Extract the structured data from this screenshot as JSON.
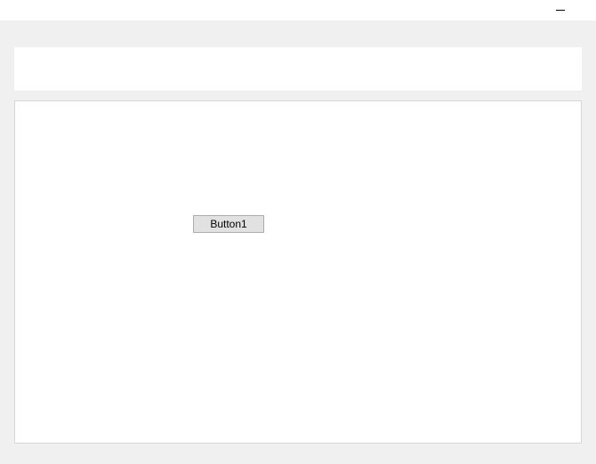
{
  "titlebar": {
    "minimize_icon": "minimize-icon"
  },
  "main": {
    "button1_label": "Button1"
  }
}
